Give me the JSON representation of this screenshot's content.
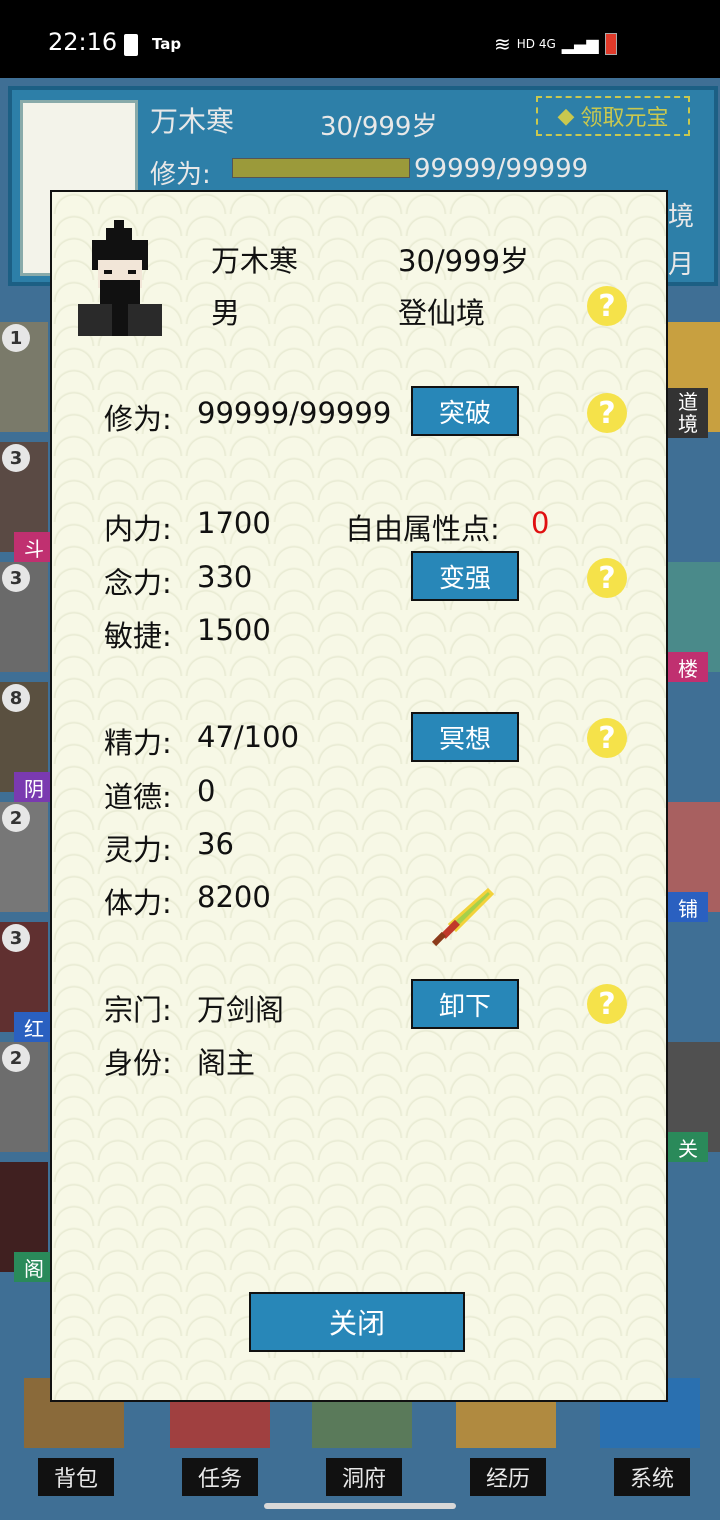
{
  "status_bar": {
    "time": "22:16",
    "carrier_label": "Tap",
    "network": "HD 4G"
  },
  "background": {
    "player_name": "万木寒",
    "age": "30/999岁",
    "cultivation_label": "修为:",
    "cultivation_value": "99999/99999",
    "claim_button": "领取元宝",
    "right_fragments": [
      "境",
      "月"
    ],
    "side_badges": [
      "1",
      "3",
      "3",
      "8",
      "2",
      "3",
      "2"
    ],
    "side_labels_left": [
      "斗",
      "阴",
      "红",
      "阁"
    ],
    "side_labels_right": [
      "道\n境",
      "楼",
      "铺",
      "关"
    ],
    "nav": [
      "背包",
      "任务",
      "洞府",
      "经历",
      "系统"
    ]
  },
  "dialog": {
    "name": "万木寒",
    "age": "30/999岁",
    "gender": "男",
    "realm": "登仙境",
    "cultivation_label": "修为:",
    "cultivation_value": "99999/99999",
    "breakthrough_button": "突破",
    "neili_label": "内力:",
    "neili_value": "1700",
    "free_points_label": "自由属性点:",
    "free_points_value": "0",
    "nianli_label": "念力:",
    "nianli_value": "330",
    "strengthen_button": "变强",
    "minjie_label": "敏捷:",
    "minjie_value": "1500",
    "jingli_label": "精力:",
    "jingli_value": "47/100",
    "meditate_button": "冥想",
    "daode_label": "道德:",
    "daode_value": "0",
    "lingli_label": "灵力:",
    "lingli_value": "36",
    "tili_label": "体力:",
    "tili_value": "8200",
    "sect_label": "宗门:",
    "sect_value": "万剑阁",
    "unequip_button": "卸下",
    "identity_label": "身份:",
    "identity_value": "阁主",
    "close_button": "关闭",
    "help_symbol": "?"
  },
  "colors": {
    "button_blue": "#2887b8",
    "help_yellow": "#f5e24a",
    "free_points_red": "#e01010",
    "dialog_bg": "#f7f8e6"
  }
}
